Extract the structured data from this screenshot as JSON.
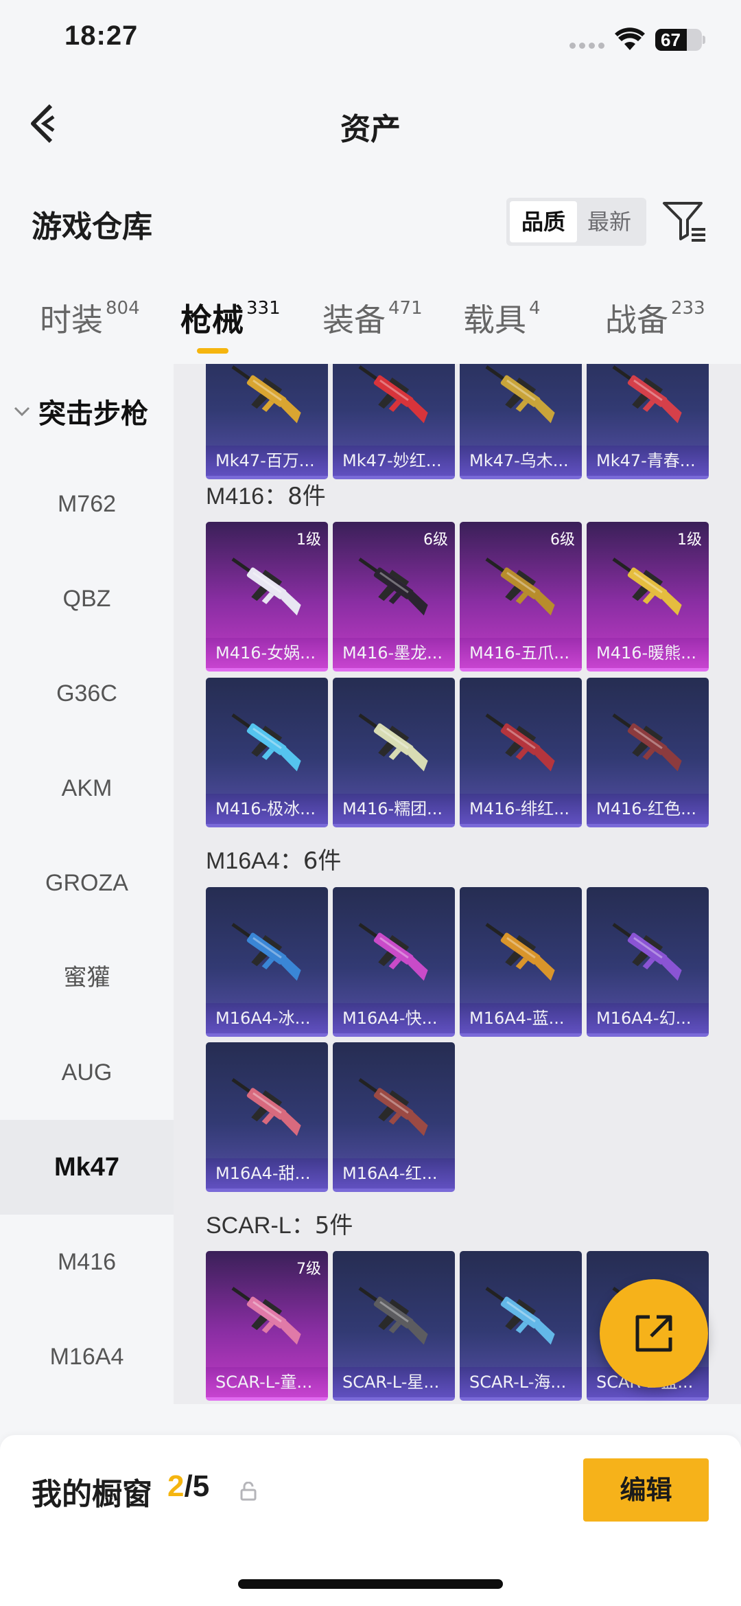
{
  "status": {
    "time": "18:27",
    "battery": "67",
    "battery_level": 0.67
  },
  "nav": {
    "title": "资产"
  },
  "header": {
    "title": "游戏仓库",
    "sort_active": "品质",
    "sort_other": "最新"
  },
  "tabs": [
    {
      "label": "时装",
      "count": "804"
    },
    {
      "label": "枪械",
      "count": "331"
    },
    {
      "label": "装备",
      "count": "471"
    },
    {
      "label": "载具",
      "count": "4"
    },
    {
      "label": "战备",
      "count": "233"
    }
  ],
  "active_tab": "枪械",
  "categories": {
    "group": "突击步枪",
    "items": [
      "M762",
      "QBZ",
      "G36C",
      "AKM",
      "GROZA",
      "蜜獾",
      "AUG",
      "Mk47",
      "M416",
      "M16A4"
    ],
    "active": "Mk47"
  },
  "groups": {
    "mk47": {
      "items": [
        {
          "name": "Mk47-百万...",
          "rarity": "blue",
          "color": "#d9a531"
        },
        {
          "name": "Mk47-妙红...",
          "rarity": "blue",
          "color": "#d8343b"
        },
        {
          "name": "Mk47-乌木...",
          "rarity": "blue",
          "color": "#c9a43a"
        },
        {
          "name": "Mk47-青春...",
          "rarity": "blue",
          "color": "#d5404a"
        }
      ]
    },
    "m416": {
      "label": "M416",
      "count": "8件",
      "items": [
        {
          "name": "M416-女娲...",
          "level": "1级",
          "rarity": "pink",
          "color": "#e8e6f2"
        },
        {
          "name": "M416-墨龙...",
          "level": "6级",
          "rarity": "pink",
          "color": "#2a2430"
        },
        {
          "name": "M416-五爪...",
          "level": "6级",
          "rarity": "pink",
          "color": "#b88d2c"
        },
        {
          "name": "M416-暖熊...",
          "level": "1级",
          "rarity": "pink",
          "color": "#e5bd3f"
        },
        {
          "name": "M416-极冰...",
          "rarity": "blue",
          "color": "#55c4ef"
        },
        {
          "name": "M416-糯团...",
          "rarity": "blue",
          "color": "#d8dcb4"
        },
        {
          "name": "M416-绯红...",
          "rarity": "blue",
          "color": "#b5353d"
        },
        {
          "name": "M416-红色...",
          "rarity": "blue",
          "color": "#8c3b3e"
        }
      ]
    },
    "m16a4": {
      "label": "M16A4",
      "count": "6件",
      "items": [
        {
          "name": "M16A4-冰...",
          "rarity": "blue",
          "color": "#3a86d6"
        },
        {
          "name": "M16A4-快...",
          "rarity": "blue",
          "color": "#c94bc9"
        },
        {
          "name": "M16A4-蓝...",
          "rarity": "blue",
          "color": "#d9952b"
        },
        {
          "name": "M16A4-幻...",
          "rarity": "blue",
          "color": "#8a54d4"
        },
        {
          "name": "M16A4-甜...",
          "rarity": "blue",
          "color": "#d86a7e"
        },
        {
          "name": "M16A4-红...",
          "rarity": "blue",
          "color": "#9b4a44"
        }
      ]
    },
    "scarl": {
      "label": "SCAR-L",
      "count": "5件",
      "items": [
        {
          "name": "SCAR-L-童...",
          "level": "7级",
          "rarity": "pink",
          "color": "#e07aa8"
        },
        {
          "name": "SCAR-L-星...",
          "rarity": "blue",
          "color": "#5c5c60"
        },
        {
          "name": "SCAR-L-海...",
          "rarity": "blue",
          "color": "#63b8e8"
        },
        {
          "name": "SCAR-L-蓝...",
          "rarity": "blue",
          "color": "#c03a3a"
        }
      ]
    }
  },
  "showcase": {
    "title": "我的橱窗",
    "current": "2",
    "total": "/5",
    "edit_label": "编辑"
  }
}
